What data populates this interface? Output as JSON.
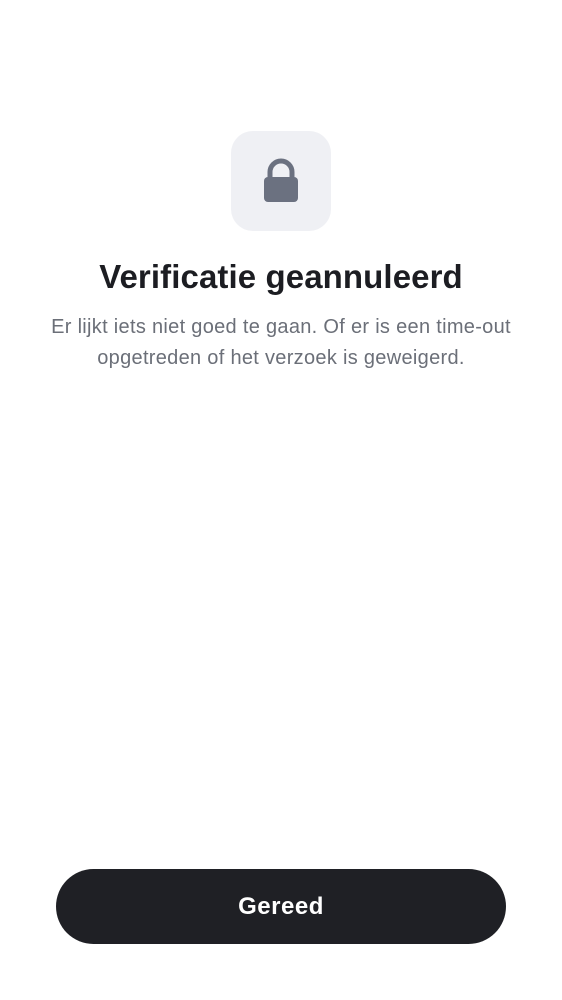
{
  "status_icon": "lock-icon",
  "colors": {
    "icon_tile_background": "#eff0f4",
    "icon": "#6b7180",
    "title": "#1c1d22",
    "message": "#6b6f78",
    "button_background": "#1f2025",
    "button_text": "#ffffff"
  },
  "title": "Verificatie geannuleerd",
  "message": "Er lijkt iets niet goed te gaan. Of er is een time-out opgetreden of het verzoek is geweigerd.",
  "done_button": {
    "label": "Gereed"
  }
}
